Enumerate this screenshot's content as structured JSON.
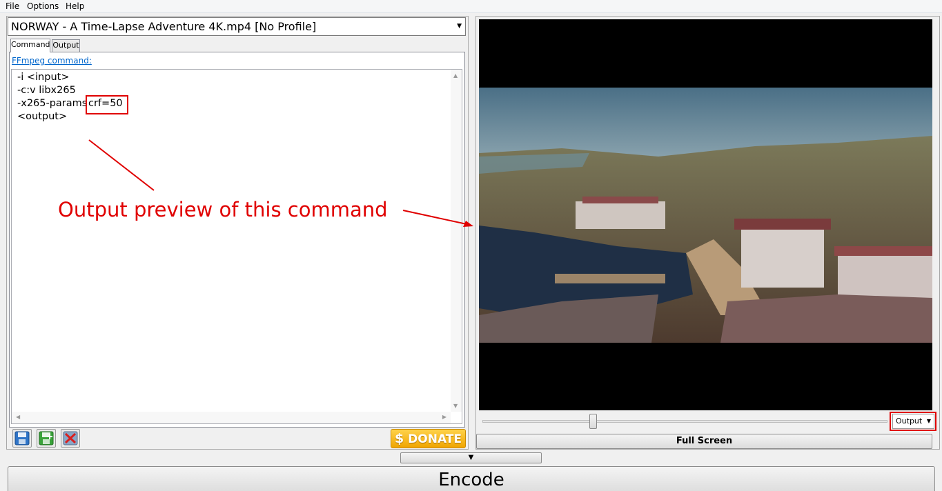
{
  "menu": {
    "items": [
      {
        "label": "File"
      },
      {
        "label": "Options"
      },
      {
        "label": "Help"
      }
    ]
  },
  "profile_select": {
    "value": "NORWAY - A Time-Lapse Adventure 4K.mp4 [No Profile]"
  },
  "tabs": [
    {
      "label": "Command",
      "active": true
    },
    {
      "label": "Output",
      "active": false
    }
  ],
  "command_panel": {
    "link_label": "FFmpeg command:",
    "lines": [
      "-i <input>",
      "-c:v libx265",
      "-x265-params",
      "<output>"
    ],
    "highlighted_param": "crf=50"
  },
  "toolbar_icons": [
    {
      "name": "save-icon"
    },
    {
      "name": "save-as-icon"
    },
    {
      "name": "delete-icon"
    }
  ],
  "donate": {
    "label": "DONATE",
    "symbol": "$"
  },
  "annotation": {
    "text": "Output preview of this command",
    "color": "#e00000"
  },
  "preview": {
    "mode_select": "Output",
    "fullscreen_label": "Full Screen"
  },
  "encode": {
    "label": "Encode"
  }
}
